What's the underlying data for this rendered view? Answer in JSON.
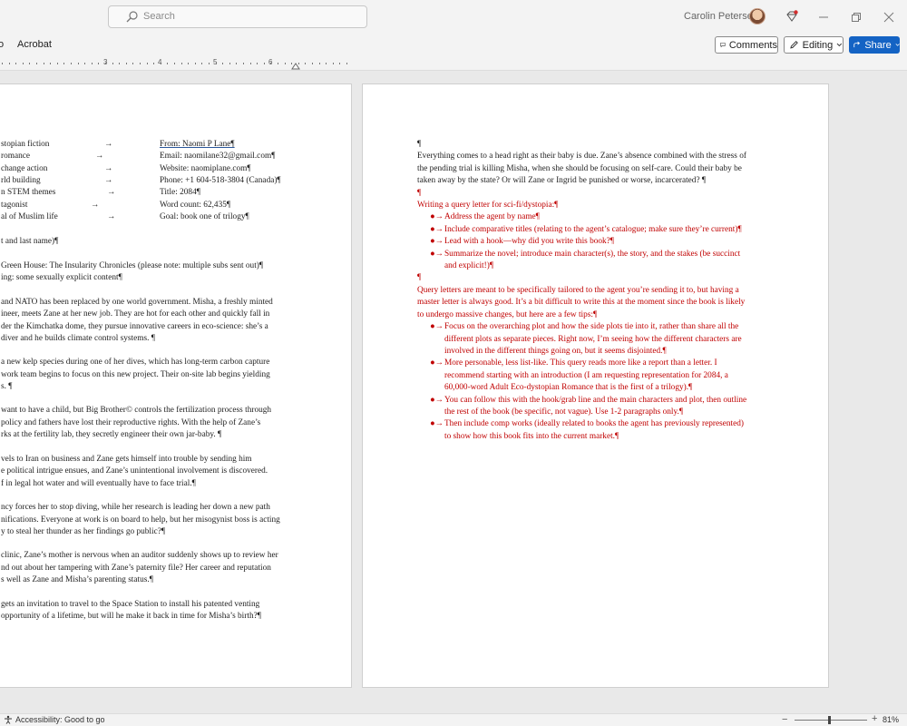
{
  "titlebar": {
    "search_placeholder": "Search",
    "user_name": "Carolin Petersen"
  },
  "ribbon": {
    "tab_partial": "o",
    "tab_acrobat": "Acrobat",
    "comments_label": "Comments",
    "editing_label": "Editing",
    "share_label": "Share"
  },
  "ruler": {
    "numbers": [
      "3",
      "4",
      "5",
      "6"
    ]
  },
  "page1": {
    "kv": [
      {
        "left": "stopian fiction",
        "arrow": "→",
        "right": "From: Naomi P Lane¶"
      },
      {
        "left": "romance",
        "arrow": "→",
        "right": "Email: naomilane32@gmail.com¶"
      },
      {
        "left": "change action",
        "arrow": "→",
        "right": "Website: naomiplane.com¶"
      },
      {
        "left": "rld building",
        "arrow": "→",
        "right": "Phone: +1 604-518-3804 (Canada)¶"
      },
      {
        "left": "n STEM themes",
        "arrow": "→",
        "right": "Title: 2084¶"
      },
      {
        "left": "tagonist",
        "arrow": "→",
        "right": "Word count: 62,435¶"
      },
      {
        "left": "al of Muslim life",
        "arrow": "→",
        "right": "Goal: book one of trilogy¶"
      }
    ],
    "lines": [
      "t and last name)¶",
      "Green House: The Insularity Chronicles (please note: multiple subs sent out)¶",
      "ing: some sexually explicit content¶",
      "and NATO has been replaced by one world government. Misha, a freshly minted",
      "ineer, meets Zane at her new job. They are hot for each other and quickly fall in",
      "der the Kimchatka dome, they pursue innovative careers in eco-science: she’s a",
      "diver and he builds climate control systems. ¶",
      "a new kelp species during one of her dives, which has long-term carbon capture",
      "work team begins to focus on this new project. Their on-site lab begins yielding",
      "s. ¶",
      "want to have a child, but Big Brother© controls the fertilization process through",
      "policy and fathers have lost their reproductive rights. With the help of Zane’s",
      "rks at the fertility lab, they secretly engineer their own jar-baby. ¶",
      "vels to Iran on business and Zane gets himself into trouble by sending him",
      "e political intrigue ensues, and Zane’s unintentional involvement is discovered.",
      "f in legal hot water and will eventually have to face trial.¶",
      "ncy forces her to stop diving, while her research is leading her down a new path",
      "nifications. Everyone at work is on board to help, but her misogynist boss is acting",
      "y to steal her thunder as her findings go public?¶",
      "clinic, Zane’s mother is nervous when an auditor suddenly shows up to review her",
      "nd out about her tampering with Zane’s paternity file? Her career and reputation",
      "s well as Zane and Misha’s parenting status.¶",
      "gets an invitation to travel to the Space Station to install his patented venting",
      "opportunity of a lifetime, but will he make it back in time for Misha’s birth?¶"
    ]
  },
  "page2": {
    "pilcrow_top": "¶",
    "para1": [
      "Everything comes to a head right as their baby is due. Zane’s absence combined with the stress of",
      "the pending trial is killing Misha, when she should be focusing on self-care. Could their baby be",
      "taken away by the state? Or will Zane or Ingrid be punished or worse, incarcerated? ¶"
    ],
    "pilcrow_2": "¶",
    "heading": "Writing a query letter for sci-fi/dystopia:¶",
    "bullets1": [
      [
        "Address the agent by name¶"
      ],
      [
        "Include comparative titles (relating to the agent’s catalogue; make sure they’re current)¶"
      ],
      [
        "Lead with a hook—why did you write this book?¶"
      ],
      [
        "Summarize the novel; introduce main character(s), the story, and the stakes (be succinct",
        "and explicit!)¶"
      ]
    ],
    "pilcrow_3": "¶",
    "para2": [
      "Query letters are meant to be specifically tailored to the agent you’re sending it to, but having a",
      "master letter is always good. It’s a bit difficult to write this at the moment since the book is likely",
      "to undergo massive changes, but here are a few tips:¶"
    ],
    "bullets2": [
      [
        "Focus on the overarching plot and how the side plots tie into it, rather than share all the",
        "different plots as separate pieces. Right now, I’m seeing how the different characters are",
        "involved in the different things going on, but it seems disjointed.¶"
      ],
      [
        "More personable, less list-like. This query reads more like a report than a letter. I",
        "recommend starting with an introduction (I am requesting representation for 2084, a",
        "60,000-word Adult Eco-dystopian Romance that is the first of a trilogy).¶"
      ],
      [
        "You can follow this with the hook/grab line and the main characters and plot, then outline",
        "the rest of the book (be specific, not vague). Use 1-2 paragraphs only.¶"
      ],
      [
        "Then include comp works (ideally related to books the agent has previously represented)",
        "to show how this book fits into the current market.¶"
      ]
    ],
    "bullet_glyph": "●→"
  },
  "statusbar": {
    "accessibility": "Accessibility: Good to go",
    "zoom_minus": "−",
    "zoom_plus": "+",
    "zoom": "81%"
  }
}
